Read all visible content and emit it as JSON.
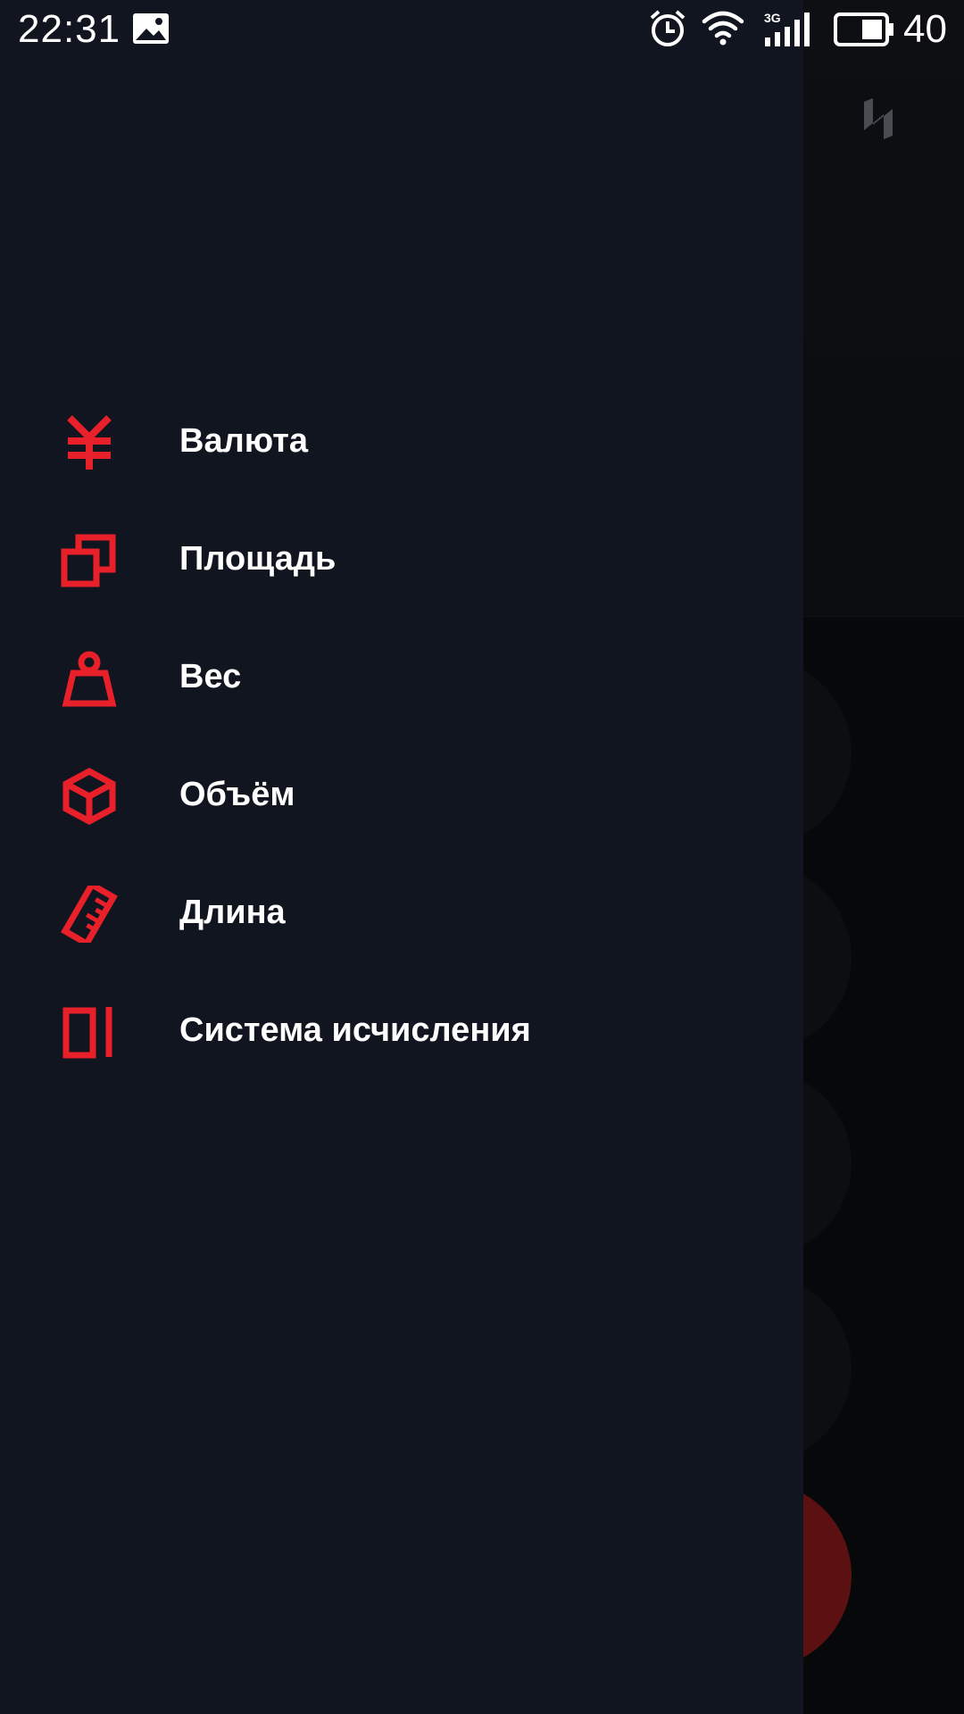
{
  "status_bar": {
    "time": "22:31",
    "network_label": "3G",
    "battery_level": "40",
    "icons": [
      "image-notification-icon",
      "alarm-icon",
      "wifi-icon",
      "cellular-signal-icon",
      "battery-icon"
    ]
  },
  "colors": {
    "drawer_background": "#111520",
    "accent": "#e8202a",
    "text": "#ffffff"
  },
  "menu": {
    "items": [
      {
        "label": "Валюта",
        "icon": "yen-currency-icon"
      },
      {
        "label": "Площадь",
        "icon": "area-squares-icon"
      },
      {
        "label": "Вес",
        "icon": "weight-icon"
      },
      {
        "label": "Объём",
        "icon": "volume-cube-icon"
      },
      {
        "label": "Длина",
        "icon": "ruler-icon"
      },
      {
        "label": "Система исчисления",
        "icon": "number-system-icon"
      }
    ]
  }
}
